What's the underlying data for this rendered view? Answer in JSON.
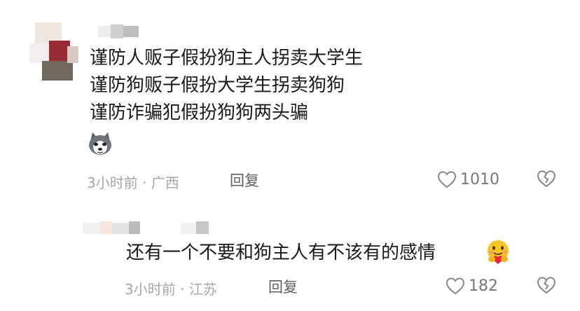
{
  "comments": [
    {
      "lines": [
        "谨防人贩子假扮狗主人拐卖大学生",
        "谨防狗贩子假扮大学生拐卖狗狗",
        "谨防诈骗犯假扮狗狗两头骗"
      ],
      "emoji": "husky-emoji",
      "time": "3小时前",
      "location": "广西",
      "reply_label": "回复",
      "like_count": "1010"
    },
    {
      "text": "还有一个不要和狗主人有不该有的感情",
      "emoji": "hug-emoji",
      "time": "3小时前",
      "location": "江苏",
      "reply_label": "回复",
      "like_count": "182"
    }
  ],
  "meta_separator": " · "
}
